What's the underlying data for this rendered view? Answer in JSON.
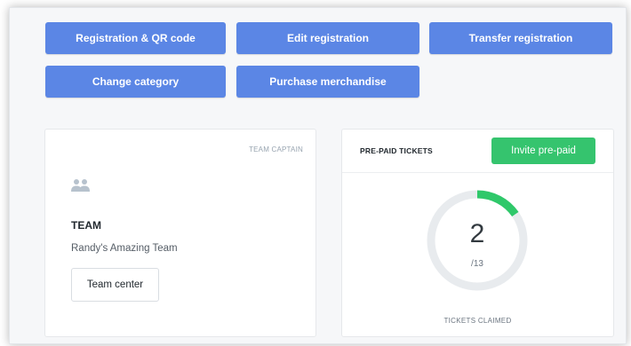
{
  "actions": {
    "registration_qr": "Registration & QR code",
    "edit_registration": "Edit registration",
    "transfer_registration": "Transfer registration",
    "change_category": "Change category",
    "purchase_merchandise": "Purchase merchandise"
  },
  "team_card": {
    "role_label": "TEAM CAPTAIN",
    "icon": "team-icon",
    "title": "TEAM",
    "team_name": "Randy's Amazing Team",
    "team_center_button": "Team center"
  },
  "tickets_card": {
    "title": "PRE-PAID TICKETS",
    "invite_button": "Invite pre-paid",
    "claimed": "2",
    "total": "/13",
    "claimed_value": 2,
    "total_value": 13,
    "claimed_label": "TICKETS CLAIMED"
  },
  "colors": {
    "primary_button": "#5b86e5",
    "success_button": "#35c46e",
    "donut_progress": "#2fc86a",
    "donut_track": "#e8ebee"
  }
}
